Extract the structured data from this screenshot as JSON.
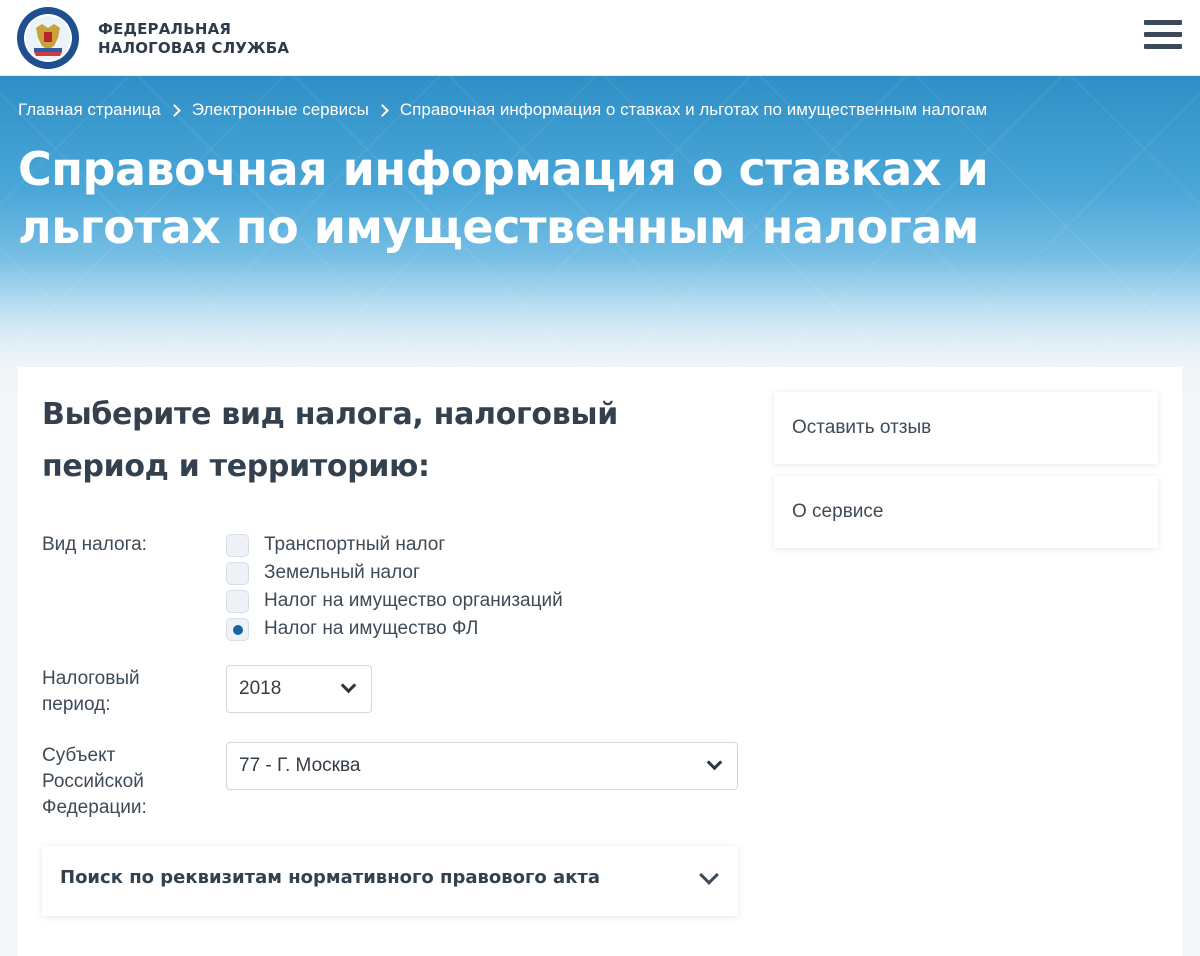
{
  "header": {
    "logo_line1": "ФЕДЕРАЛЬНАЯ",
    "logo_line2": "НАЛОГОВАЯ СЛУЖБА",
    "emblem_icon": "fns-emblem-icon",
    "menu_icon": "hamburger-menu-icon"
  },
  "breadcrumb": [
    "Главная страница",
    "Электронные сервисы",
    "Справочная информация о ставках и льготах по имущественным налогам"
  ],
  "page_title": "Справочная информация о ставках и льготах по имущественным налогам",
  "form": {
    "title": "Выберите вид налога, налоговый период и территорию:",
    "tax_type_label": "Вид налога:",
    "tax_types": [
      {
        "label": "Транспортный налог",
        "checked": false
      },
      {
        "label": "Земельный налог",
        "checked": false
      },
      {
        "label": "Налог на имущество организаций",
        "checked": false
      },
      {
        "label": "Налог на имущество ФЛ",
        "checked": true
      }
    ],
    "period_label_1": "Налоговый",
    "period_label_2": "период:",
    "period_value": "2018",
    "region_label_1": "Субъект",
    "region_label_2": "Российской",
    "region_label_3": "Федерации:",
    "region_value": "77 - Г. Москва",
    "search_accordion": "Поиск по реквизитам нормативного правового акта"
  },
  "sidebar": {
    "feedback": "Оставить отзыв",
    "about": "О сервисе"
  },
  "colors": {
    "accent": "#1565a8",
    "hero_top": "#2f8fc6",
    "text": "#333d47"
  }
}
